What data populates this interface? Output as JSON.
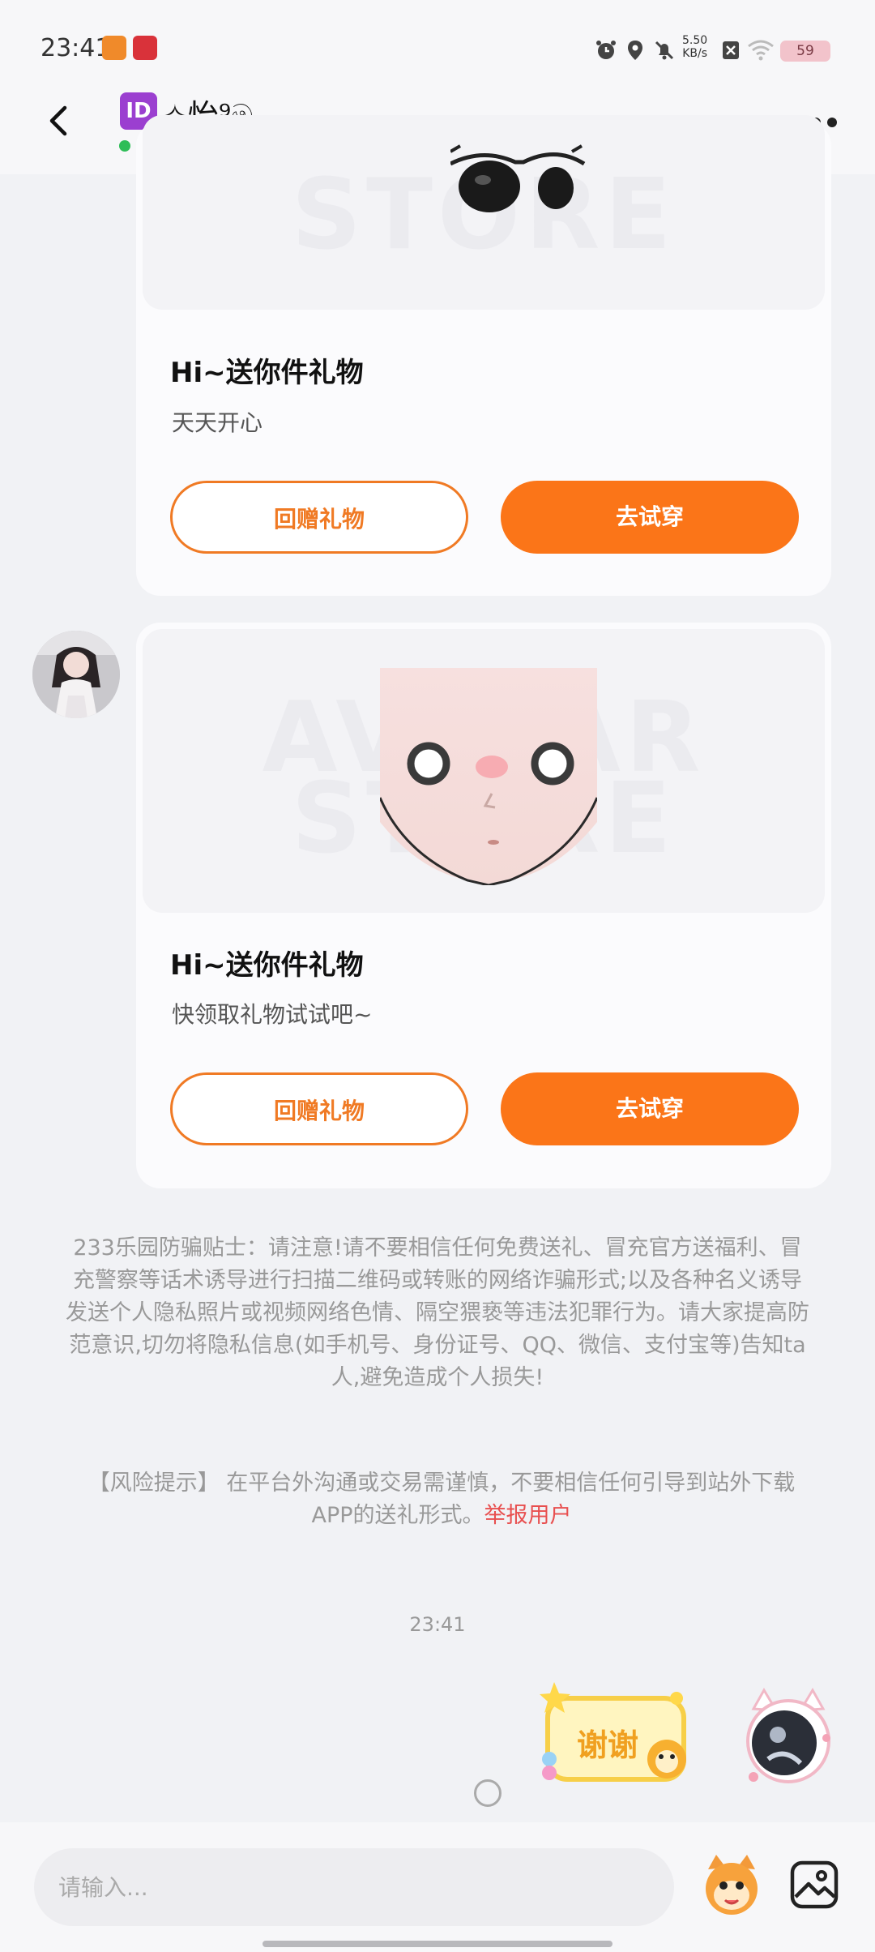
{
  "status_bar": {
    "time": "23:41",
    "net_speed_value": "5.50",
    "net_speed_unit": "KB/s",
    "battery": "59",
    "icons": [
      "app-icon-orange",
      "app-icon-red",
      "alarm-icon",
      "location-icon",
      "mute-icon",
      "signal-off-icon",
      "wifi-icon",
      "battery-icon"
    ]
  },
  "header": {
    "badge": "ID",
    "name": "✧怡⁹ම.",
    "status": "在线"
  },
  "cards": [
    {
      "image": "sunglasses-gift",
      "watermark": "STORE",
      "title": "Hi~送你件礼物",
      "message": "天天开心",
      "btn_return": "回赠礼物",
      "btn_try": "去试穿"
    },
    {
      "image": "face-gift",
      "watermark_top": "AVATAR",
      "watermark": "STORE",
      "title": "Hi~送你件礼物",
      "message": "快领取礼物试试吧~",
      "btn_return": "回赠礼物",
      "btn_try": "去试穿"
    }
  ],
  "anti_fraud_notice": "233乐园防骗贴士：请注意!请不要相信任何免费送礼、冒充官方送福利、冒充警察等话术诱导进行扫描二维码或转账的网络诈骗形式;以及各种名义诱导发送个人隐私照片或视频网络色情、隔空猥亵等违法犯罪行为。请大家提高防范意识,切勿将隐私信息(如手机号、身份证号、QQ、微信、支付宝等)告知ta人,避免造成个人损失!",
  "risk_notice": {
    "text": "【风险提示】 在平台外沟通或交易需谨慎，不要相信任何引导到站外下载APP的送礼形式。",
    "report_link": "举报用户"
  },
  "message_time": "23:41",
  "sticker_text": "谢谢",
  "input": {
    "placeholder": "请输入..."
  },
  "colors": {
    "accent": "#fb7518",
    "background": "#f1f2f5",
    "online": "#2ebd57",
    "report": "#e84f4f"
  }
}
